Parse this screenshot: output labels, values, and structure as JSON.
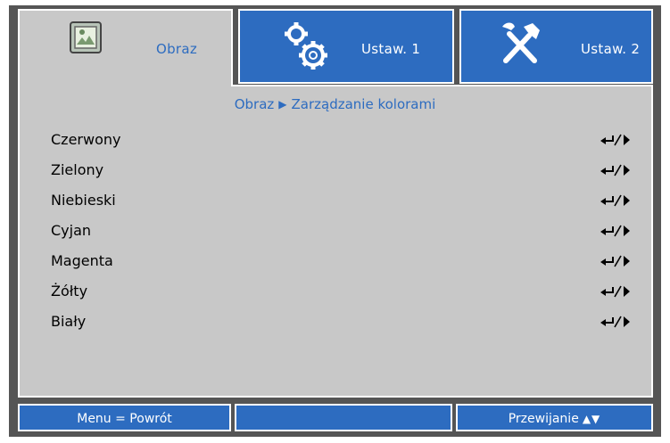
{
  "tabs": [
    {
      "label": "Obraz",
      "icon": "image-icon",
      "active": true
    },
    {
      "label": "Ustaw. 1",
      "icon": "gears-icon",
      "active": false
    },
    {
      "label": "Ustaw. 2",
      "icon": "tools-icon",
      "active": false
    }
  ],
  "breadcrumb": {
    "parent": "Obraz",
    "separator": "▶",
    "current": "Zarządzanie kolorami"
  },
  "menu": {
    "items": [
      {
        "label": "Czerwony",
        "action": "enter-right"
      },
      {
        "label": "Zielony",
        "action": "enter-right"
      },
      {
        "label": "Niebieski",
        "action": "enter-right"
      },
      {
        "label": "Cyjan",
        "action": "enter-right"
      },
      {
        "label": "Magenta",
        "action": "enter-right"
      },
      {
        "label": "Żółty",
        "action": "enter-right"
      },
      {
        "label": "Biały",
        "action": "enter-right"
      }
    ]
  },
  "footer": {
    "back": "Menu = Powrót",
    "middle": "",
    "scroll": "Przewijanie",
    "scroll_arrows": "▲▼"
  },
  "colors": {
    "accent": "#2d6cc0",
    "panel": "#c8c8c8",
    "frame": "#555555"
  }
}
